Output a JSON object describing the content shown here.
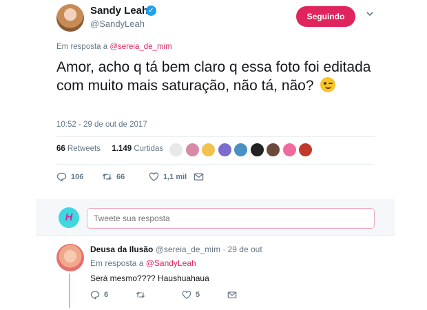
{
  "author": {
    "name": "Sandy Leah",
    "handle": "@SandyLeah",
    "verified": true
  },
  "follow_button": "Seguindo",
  "reply_to": {
    "prefix": "Em resposta a",
    "handle": "@sereia_de_mim"
  },
  "tweet_text": "Amor, acho q tá bem claro q essa foto foi editada com muito mais saturação, não tá, não?",
  "timestamp": "10:52 - 29 de out de 2017",
  "stats": {
    "retweets_count": "66",
    "retweets_label": "Retweets",
    "likes_count": "1.149",
    "likes_label": "Curtidas"
  },
  "liker_avatars": [
    {
      "name": "liker-1",
      "color": "#e8e8e8"
    },
    {
      "name": "liker-2",
      "color": "#d98aa6"
    },
    {
      "name": "liker-3",
      "color": "#f2c14e"
    },
    {
      "name": "liker-4",
      "color": "#7b6ccf"
    },
    {
      "name": "liker-5",
      "color": "#4a90c2"
    },
    {
      "name": "liker-6",
      "color": "#222222"
    },
    {
      "name": "liker-7",
      "color": "#6b4a3a"
    },
    {
      "name": "liker-8",
      "color": "#f06aa0"
    },
    {
      "name": "liker-9",
      "color": "#c0392b"
    }
  ],
  "actions": {
    "replies": "106",
    "retweets": "66",
    "likes": "1,1 mil"
  },
  "reply_box": {
    "placeholder": "Tweete sua resposta",
    "avatar_text": "H"
  },
  "reply_tweet": {
    "name": "Deusa da Ilusão",
    "handle": "@sereia_de_mim",
    "date": "· 29 de out",
    "reply_prefix": "Em resposta a",
    "reply_handle": "@SandyLeah",
    "text": "Será mesmo???? Haushuahaua",
    "replies": "6",
    "likes": "5"
  },
  "colors": {
    "accent": "#e0245e",
    "verified": "#1da1f2",
    "muted": "#657786",
    "text": "#14171a"
  }
}
